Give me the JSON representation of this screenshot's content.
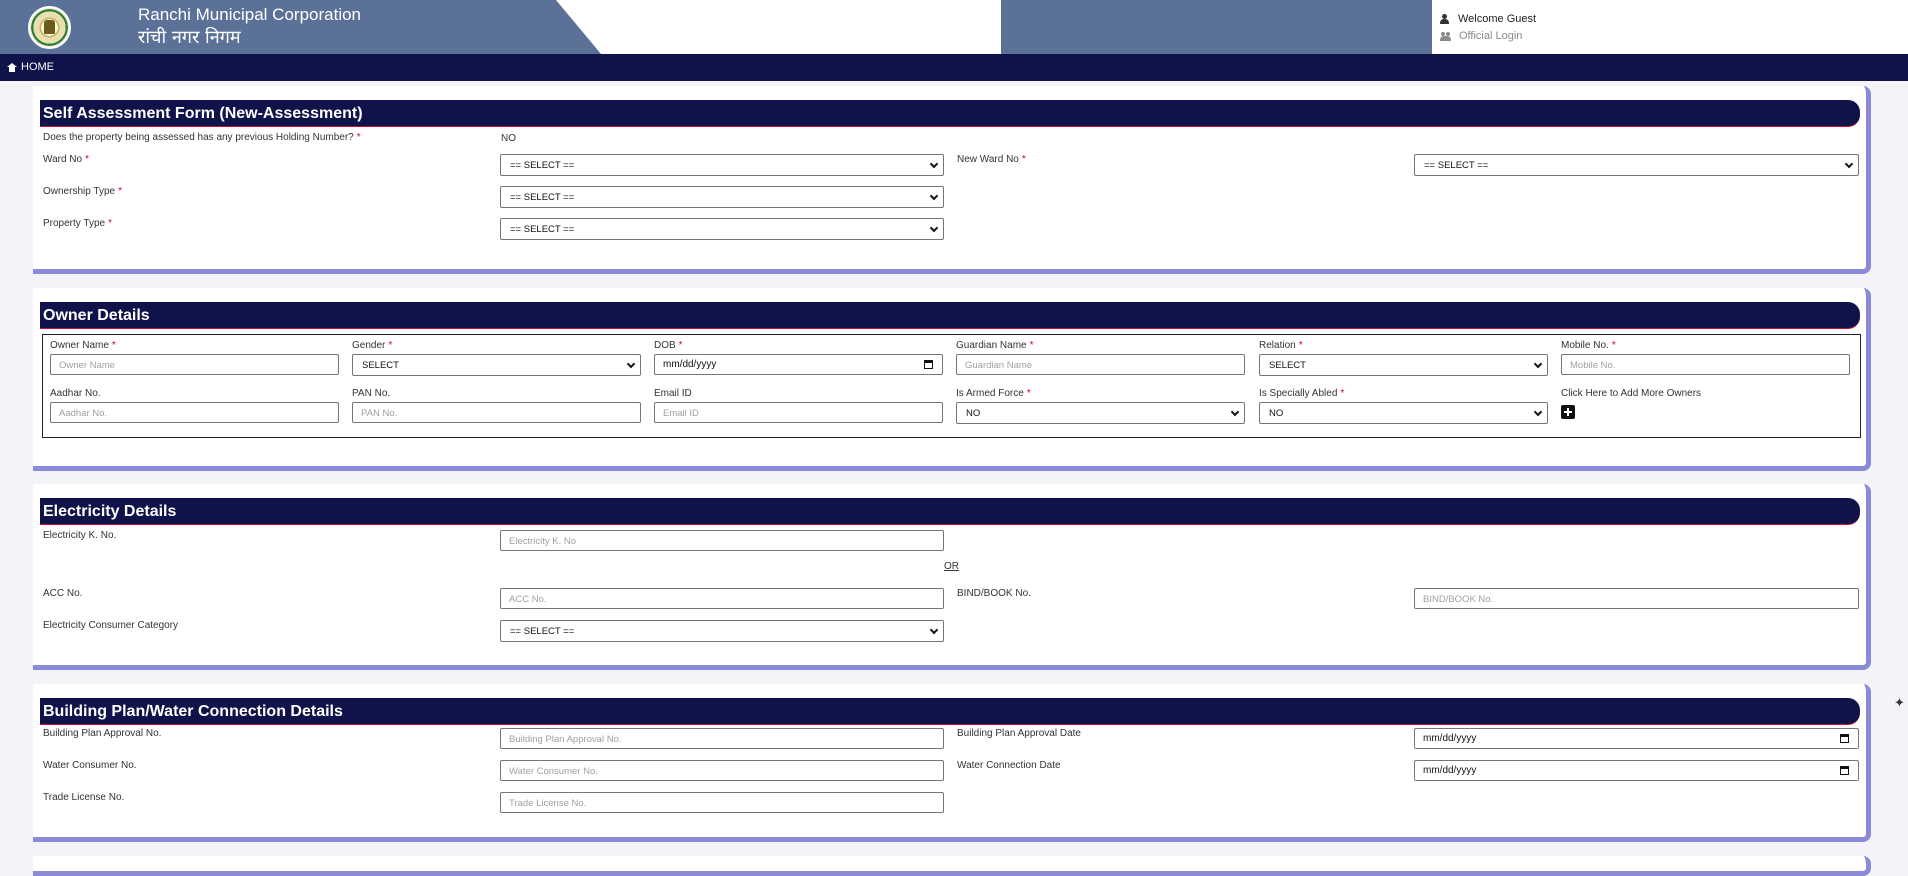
{
  "header": {
    "org_en": "Ranchi Municipal Corporation",
    "org_hi": "रांची नगर निगम",
    "welcome": "Welcome Guest",
    "official_login": "Official Login"
  },
  "nav": {
    "home": "HOME"
  },
  "self_assessment": {
    "title": "Self Assessment Form (New-Assessment)",
    "prev_holding_label": "Does the property being assessed has any previous Holding Number?",
    "prev_holding_value": "NO",
    "ward_no_label": "Ward No",
    "ward_no_value": "== SELECT ==",
    "new_ward_no_label": "New Ward No",
    "new_ward_no_value": "== SELECT ==",
    "ownership_type_label": "Ownership Type",
    "ownership_type_value": "== SELECT ==",
    "property_type_label": "Property Type",
    "property_type_value": "== SELECT =="
  },
  "owner": {
    "title": "Owner Details",
    "owner_name_label": "Owner Name",
    "owner_name_placeholder": "Owner Name",
    "gender_label": "Gender",
    "gender_value": "SELECT",
    "dob_label": "DOB",
    "dob_value": "mm/dd/yyyy",
    "guardian_name_label": "Guardian Name",
    "guardian_name_placeholder": "Guardian Name",
    "relation_label": "Relation",
    "relation_value": "SELECT",
    "mobile_label": "Mobile No.",
    "mobile_placeholder": "Mobile No.",
    "aadhar_label": "Aadhar No.",
    "aadhar_placeholder": "Aadhar No.",
    "pan_label": "PAN No.",
    "pan_placeholder": "PAN No.",
    "email_label": "Email ID",
    "email_placeholder": "Email ID",
    "armed_force_label": "Is Armed Force",
    "armed_force_value": "NO",
    "specially_abled_label": "Is Specially Abled",
    "specially_abled_value": "NO",
    "add_more_label": "Click Here to Add More Owners"
  },
  "electricity": {
    "title": "Electricity Details",
    "k_no_label": "Electricity K. No.",
    "k_no_placeholder": "Electricity K. No",
    "or_text": "OR",
    "acc_label": "ACC No.",
    "acc_placeholder": "ACC No.",
    "bind_book_label": "BIND/BOOK No.",
    "bind_book_placeholder": "BIND/BOOK No.",
    "consumer_category_label": "Electricity Consumer Category",
    "consumer_category_value": "== SELECT =="
  },
  "building": {
    "title": "Building Plan/Water Connection Details",
    "plan_approval_no_label": "Building Plan Approval No.",
    "plan_approval_no_placeholder": "Building Plan Approval No.",
    "plan_approval_date_label": "Building Plan Approval Date",
    "plan_approval_date_value": "mm/dd/yyyy",
    "water_consumer_no_label": "Water Consumer No.",
    "water_consumer_no_placeholder": "Water Consumer No.",
    "water_connection_date_label": "Water Connection Date",
    "water_connection_date_value": "mm/dd/yyyy",
    "trade_license_label": "Trade License No.",
    "trade_license_placeholder": "Trade License No."
  },
  "required_mark": "*"
}
